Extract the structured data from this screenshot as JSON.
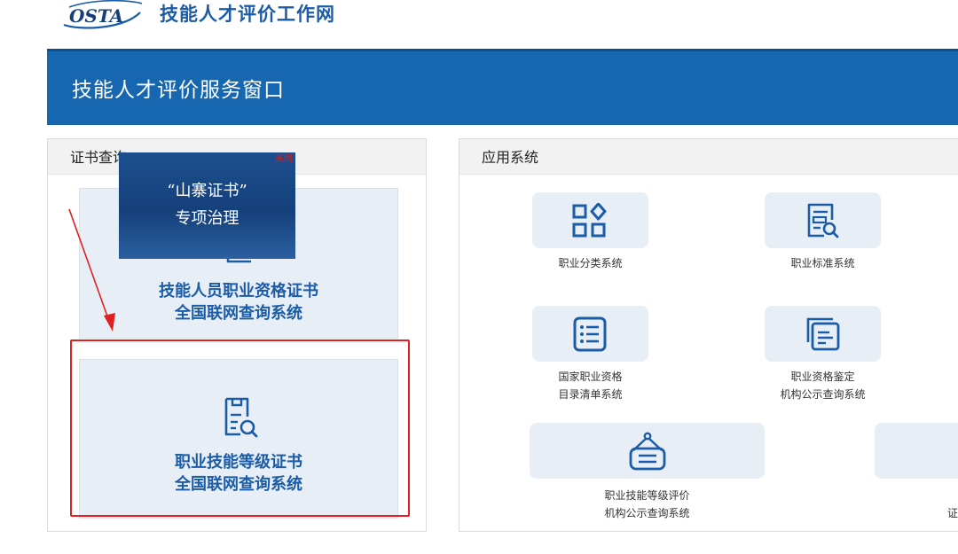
{
  "header": {
    "logo_text": "OSTA",
    "site_name": "技能人才评价工作网"
  },
  "banner": {
    "title": "技能人才评价服务窗口"
  },
  "cert_panel": {
    "title": "证书查询",
    "cards": [
      {
        "line1": "技能人员职业资格证书",
        "line2": "全国联网查询系统"
      },
      {
        "line1": "职业技能等级证书",
        "line2": "全国联网查询系统"
      }
    ]
  },
  "promo": {
    "line1": "“山寨证书”",
    "line2": "专项治理",
    "close": "关闭"
  },
  "apps_panel": {
    "title": "应用系统",
    "tiles": [
      {
        "line1": "职业分类系统",
        "line2": "",
        "icon": "grid-diamond-icon"
      },
      {
        "line1": "职业标准系统",
        "line2": "",
        "icon": "document-search-icon"
      },
      {
        "line1": "国家职业资格",
        "line2": "目录清单系统",
        "icon": "list-icon"
      },
      {
        "line1": "职业资格鉴定",
        "line2": "机构公示查询系统",
        "icon": "stacked-documents-icon"
      },
      {
        "line1": "职业技能等级评价",
        "line2": "机构公示查询系统",
        "icon": "hanging-sign-icon"
      },
      {
        "line1": "证",
        "line2": "",
        "icon": ""
      }
    ]
  },
  "colors": {
    "brand_blue": "#1766b0",
    "card_bg": "#e7eef5",
    "highlight_red": "#e02020"
  }
}
